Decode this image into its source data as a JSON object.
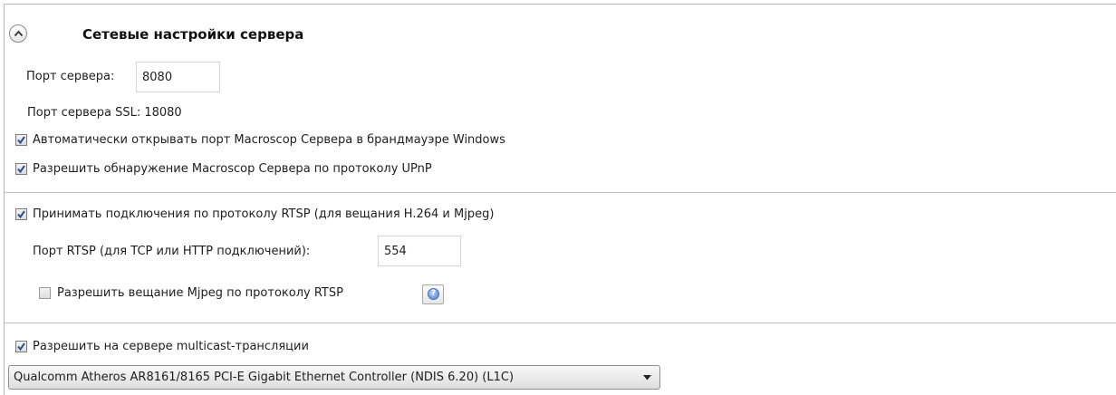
{
  "section": {
    "title": "Сетевые настройки сервера",
    "collapse_icon": "chevron-up-icon"
  },
  "server_port": {
    "label": "Порт сервера:",
    "value": "8080"
  },
  "ssl_port": {
    "text": "Порт сервера SSL: 18080"
  },
  "checkboxes": {
    "firewall": {
      "label": "Автоматически открывать порт Macroscop Сервера в брандмауэре Windows",
      "checked": true
    },
    "upnp": {
      "label": "Разрешить обнаружение Macroscop Сервера по протоколу UPnP",
      "checked": true
    },
    "rtsp": {
      "label": "Принимать подключения по протоколу RTSP (для вещания H.264 и Mjpeg)",
      "checked": true
    },
    "mjpeg_rtsp": {
      "label": "Разрешить вещание Mjpeg по протоколу RTSP",
      "checked": false
    },
    "multicast": {
      "label": "Разрешить на сервере multicast-трансляции",
      "checked": true
    }
  },
  "rtsp_port": {
    "label": "Порт RTSP (для TCP или HTTP подключений):",
    "value": "554"
  },
  "help": {
    "icon": "help-icon",
    "glyph": "?"
  },
  "network_adapter": {
    "selected": "Qualcomm Atheros AR8161/8165 PCI-E Gigabit Ethernet Controller (NDIS 6.20) (L1C)"
  },
  "colors": {
    "check_mark": "#2a4e8a",
    "divider": "#c2c2c2"
  }
}
